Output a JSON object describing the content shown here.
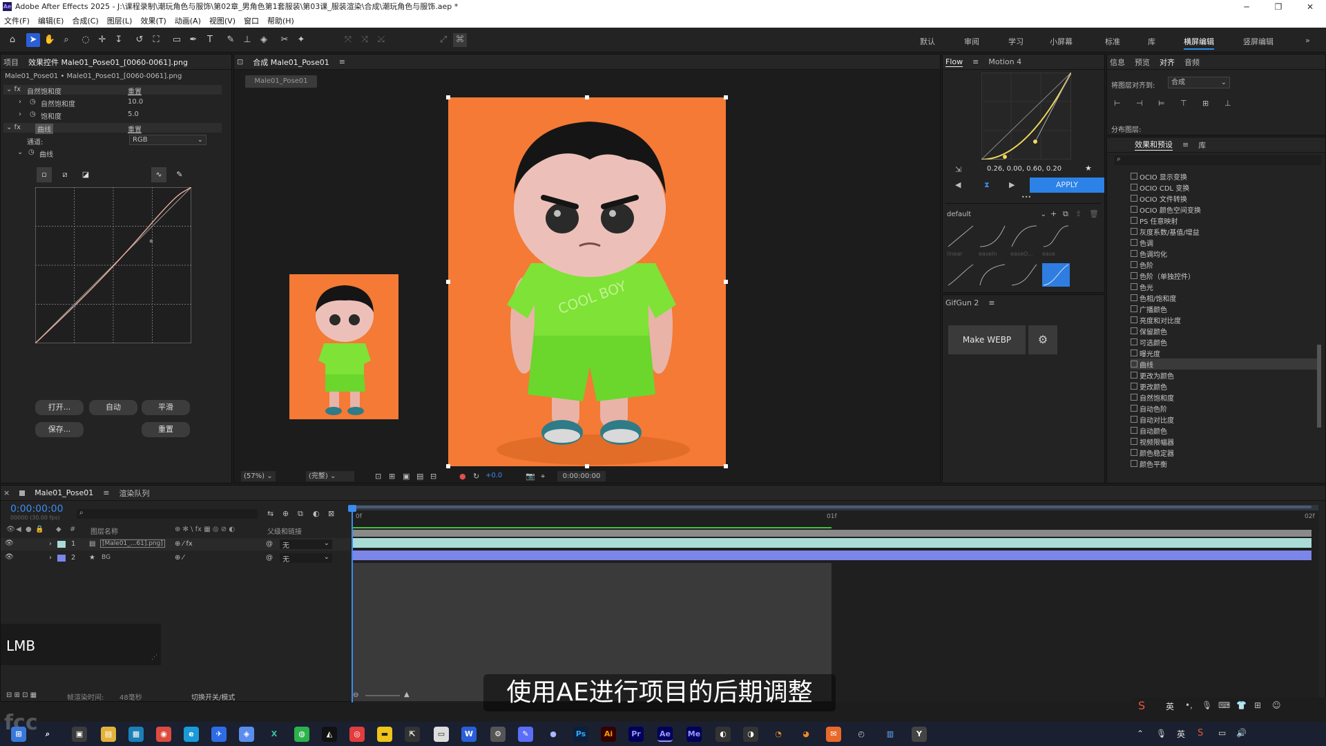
{
  "window": {
    "title": "Adobe After Effects 2025 - J:\\课程录制\\潮玩角色与服饰\\第02章_男角色第1套服装\\第03课_服装渲染\\合成\\潮玩角色与服饰.aep *",
    "minimize": "─",
    "restore": "❐",
    "close": "✕"
  },
  "menu": [
    "文件(F)",
    "编辑(E)",
    "合成(C)",
    "图层(L)",
    "效果(T)",
    "动画(A)",
    "视图(V)",
    "窗口",
    "帮助(H)"
  ],
  "toolbar": {
    "align_label": "对齐"
  },
  "workspaces": [
    "默认",
    "审阅",
    "学习",
    "小屏幕",
    "标准",
    "库",
    "横屏编辑",
    "竖屏编辑"
  ],
  "workspace_active": "横屏编辑",
  "effect_controls": {
    "tab_project": "项目",
    "tab_title": "效果控件 Male01_Pose01_[0060-0061].png",
    "path": "Male01_Pose01 • Male01_Pose01_[0060-0061].png",
    "fx1_name": "自然饱和度",
    "fx1_reset": "重置",
    "vib_label": "自然饱和度",
    "vib_value": "10.0",
    "sat_label": "饱和度",
    "sat_value": "5.0",
    "fx2_name": "曲线",
    "fx2_reset": "重置",
    "channel_label": "通道:",
    "channel_value": "RGB",
    "curves_label": "曲线",
    "btn_open": "打开...",
    "btn_auto": "自动",
    "btn_smooth": "平滑",
    "btn_save": "保存...",
    "btn_reset": "重置"
  },
  "comp": {
    "tab_title": "合成 Male01_Pose01",
    "chip": "Male01_Pose01",
    "zoom": "(57%)",
    "quality": "(完整)",
    "exposure": "+0.0",
    "timecode": "0:00:00:00",
    "bg_color": "#f47a35"
  },
  "flow": {
    "tab": "Flow",
    "tab2": "Motion 4",
    "values": "0.26, 0.00, 0.60, 0.20",
    "apply": "APPLY",
    "preset": "default",
    "more": "•••",
    "curve_labels": [
      "linear",
      "easeIn",
      "easeO...",
      "ease"
    ]
  },
  "gifgun": {
    "tab": "GifGun 2",
    "button": "Make WEBP"
  },
  "info_panel": {
    "tabs": [
      "信息",
      "预览",
      "对齐",
      "音频"
    ],
    "align_to_label": "将图层对齐到:",
    "align_to_value": "合成",
    "distribute_label": "分布图层:"
  },
  "effects_presets": {
    "tab": "效果和预设",
    "tab2": "库",
    "search_icon": "⌕",
    "items": [
      "OCIO 显示变换",
      "OCIO CDL 变换",
      "OCIO 文件转换",
      "OCIO 颜色空间变换",
      "PS 任意映射",
      "灰度系数/基值/增益",
      "色调",
      "色调均化",
      "色阶",
      "色阶（单独控件）",
      "色光",
      "色相/饱和度",
      "广播颜色",
      "亮度和对比度",
      "保留颜色",
      "可选颜色",
      "曝光度",
      "曲线",
      "更改为颜色",
      "更改颜色",
      "自然饱和度",
      "自动色阶",
      "自动对比度",
      "自动颜色",
      "视频限幅器",
      "颜色稳定器",
      "颜色平衡"
    ],
    "selected": "曲线"
  },
  "timeline": {
    "tab": "Male01_Pose01",
    "tab2": "渲染队列",
    "timecode": "0:00:00:00",
    "subtimecode": "00000 (30.00 fps)",
    "col_layer": "图层名称",
    "col_parent": "父级和链接",
    "layers": [
      {
        "num": "1",
        "name": "[Male01_...61].png]",
        "parent": "无",
        "color": "#a9dcd6"
      },
      {
        "num": "2",
        "name": "BG",
        "parent": "无",
        "color": "#7c86e8"
      }
    ],
    "ruler": [
      "0f",
      "01f",
      "02f"
    ],
    "footer_render": "帧渲染时间:",
    "footer_render_value": "48毫秒",
    "footer_toggle": "切换开关/模式"
  },
  "overlay": {
    "lmb": "LMB",
    "subtitle": "使用AE进行项目的后期调整",
    "watermark": "fcc"
  },
  "tray": {
    "ime": "英",
    "ime2": "英"
  }
}
